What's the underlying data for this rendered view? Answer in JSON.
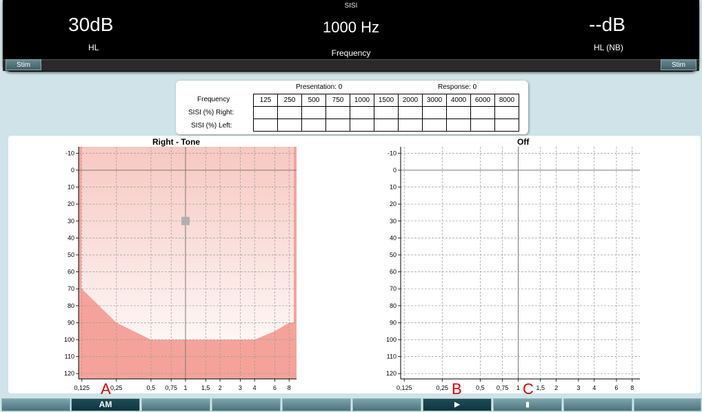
{
  "header": {
    "title": "SISI",
    "level_left": "30dB",
    "level_left_unit": "HL",
    "frequency_value": "1000 Hz",
    "frequency_label": "Frequency",
    "level_right": "--dB",
    "level_right_unit": "HL (NB)",
    "stim_left": "Stim",
    "stim_right": "Stim"
  },
  "sisi_table": {
    "presentation": "Presentation: 0",
    "response": "Response: 0",
    "row_labels": [
      "Frequency",
      "SISI (%) Right:",
      "SISI (%) Left:"
    ],
    "frequencies": [
      "125",
      "250",
      "500",
      "750",
      "1000",
      "1500",
      "2000",
      "3000",
      "4000",
      "6000",
      "8000"
    ]
  },
  "chart_data": [
    {
      "type": "line",
      "title": "Right - Tone",
      "x_tick_labels": [
        "0,125",
        "0,25",
        "0,5",
        "0,75",
        "1",
        "1,5",
        "2",
        "3",
        "4",
        "6",
        "8"
      ],
      "y_tick_labels": [
        "-10",
        "0",
        "10",
        "20",
        "30",
        "40",
        "50",
        "60",
        "70",
        "80",
        "90",
        "100",
        "110",
        "120"
      ],
      "ylim": [
        -10,
        120
      ],
      "y_inverted": true,
      "max_output_limit": [
        {
          "x": 0.125,
          "y": 70
        },
        {
          "x": 0.25,
          "y": 90
        },
        {
          "x": 0.5,
          "y": 100
        },
        {
          "x": 4,
          "y": 100
        },
        {
          "x": 6,
          "y": 95
        },
        {
          "x": 8,
          "y": 90
        }
      ],
      "current_stimulus": {
        "x": 1,
        "y": 30
      },
      "colors": {
        "title": "#a01010",
        "fill_light": "#fbe3e0",
        "fill_dark": "#f5a39a",
        "marker": "#b0b0b0"
      }
    },
    {
      "type": "line",
      "title": "Off",
      "x_tick_labels": [
        "0,125",
        "0,25",
        "0,5",
        "0,75",
        "1",
        "1,5",
        "2",
        "3",
        "4",
        "6",
        "8"
      ],
      "y_tick_labels": [
        "-10",
        "0",
        "10",
        "20",
        "30",
        "40",
        "50",
        "60",
        "70",
        "80",
        "90",
        "100",
        "110",
        "120"
      ],
      "ylim": [
        -10,
        120
      ],
      "y_inverted": true,
      "colors": {
        "title": "#000000"
      }
    }
  ],
  "markers": {
    "a": "A",
    "b": "B",
    "c": "C"
  },
  "function_keys": [
    {
      "label": ""
    },
    {
      "label": "AM"
    },
    {
      "label": ""
    },
    {
      "label": ""
    },
    {
      "label": ""
    },
    {
      "label": ""
    },
    {
      "label": "▶"
    },
    {
      "label": "▮"
    },
    {
      "label": ""
    },
    {
      "label": ""
    }
  ]
}
